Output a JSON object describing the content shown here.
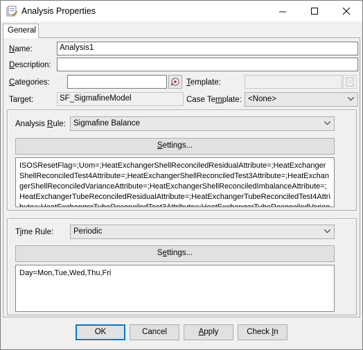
{
  "window": {
    "title": "Analysis Properties",
    "minimize_glyph": "minimize-icon",
    "maximize_glyph": "maximize-icon",
    "close_glyph": "close-icon"
  },
  "tabs": [
    {
      "label": "General"
    }
  ],
  "fields": {
    "name_label": "Name:",
    "name_value": "Analysis1",
    "description_label": "Description:",
    "description_value": "",
    "categories_label": "Categories:",
    "categories_value": "",
    "template_label": "Template:",
    "template_value": "",
    "target_label": "Target:",
    "target_value": "SF_SigmafineModel",
    "case_template_label": "Case Template:",
    "case_template_value": "<None>"
  },
  "analysis_rule": {
    "label": "Analysis Rule:",
    "value": "Sigmafine Balance",
    "settings_button": "Settings...",
    "config_text": "ISOSResetFlag=;Uom=;HeatExchangerShellReconciledResidualAttribute=;HeatExchangerShellReconciledTest4Attribute=;HeatExchangerShellReconciledTest3Attribute=;HeatExchangerShellReconciledVarianceAttribute=;HeatExchangerShellReconciledImbalanceAttribute=;HeatExchangerTubeReconciledResidualAttribute=;HeatExchangerTubeReconciledTest4Attribute=;HeatExchangerTubeReconciledTest3Attribute=;HeatExchangerTubeReconciledVarianceAt"
  },
  "time_rule": {
    "label": "Time Rule:",
    "value": "Periodic",
    "settings_button": "Settings...",
    "config_text": "Day=Mon,Tue,Wed,Thu,Fri"
  },
  "buttons": {
    "ok": "OK",
    "cancel": "Cancel",
    "apply": "Apply",
    "check_in": "Check In"
  }
}
